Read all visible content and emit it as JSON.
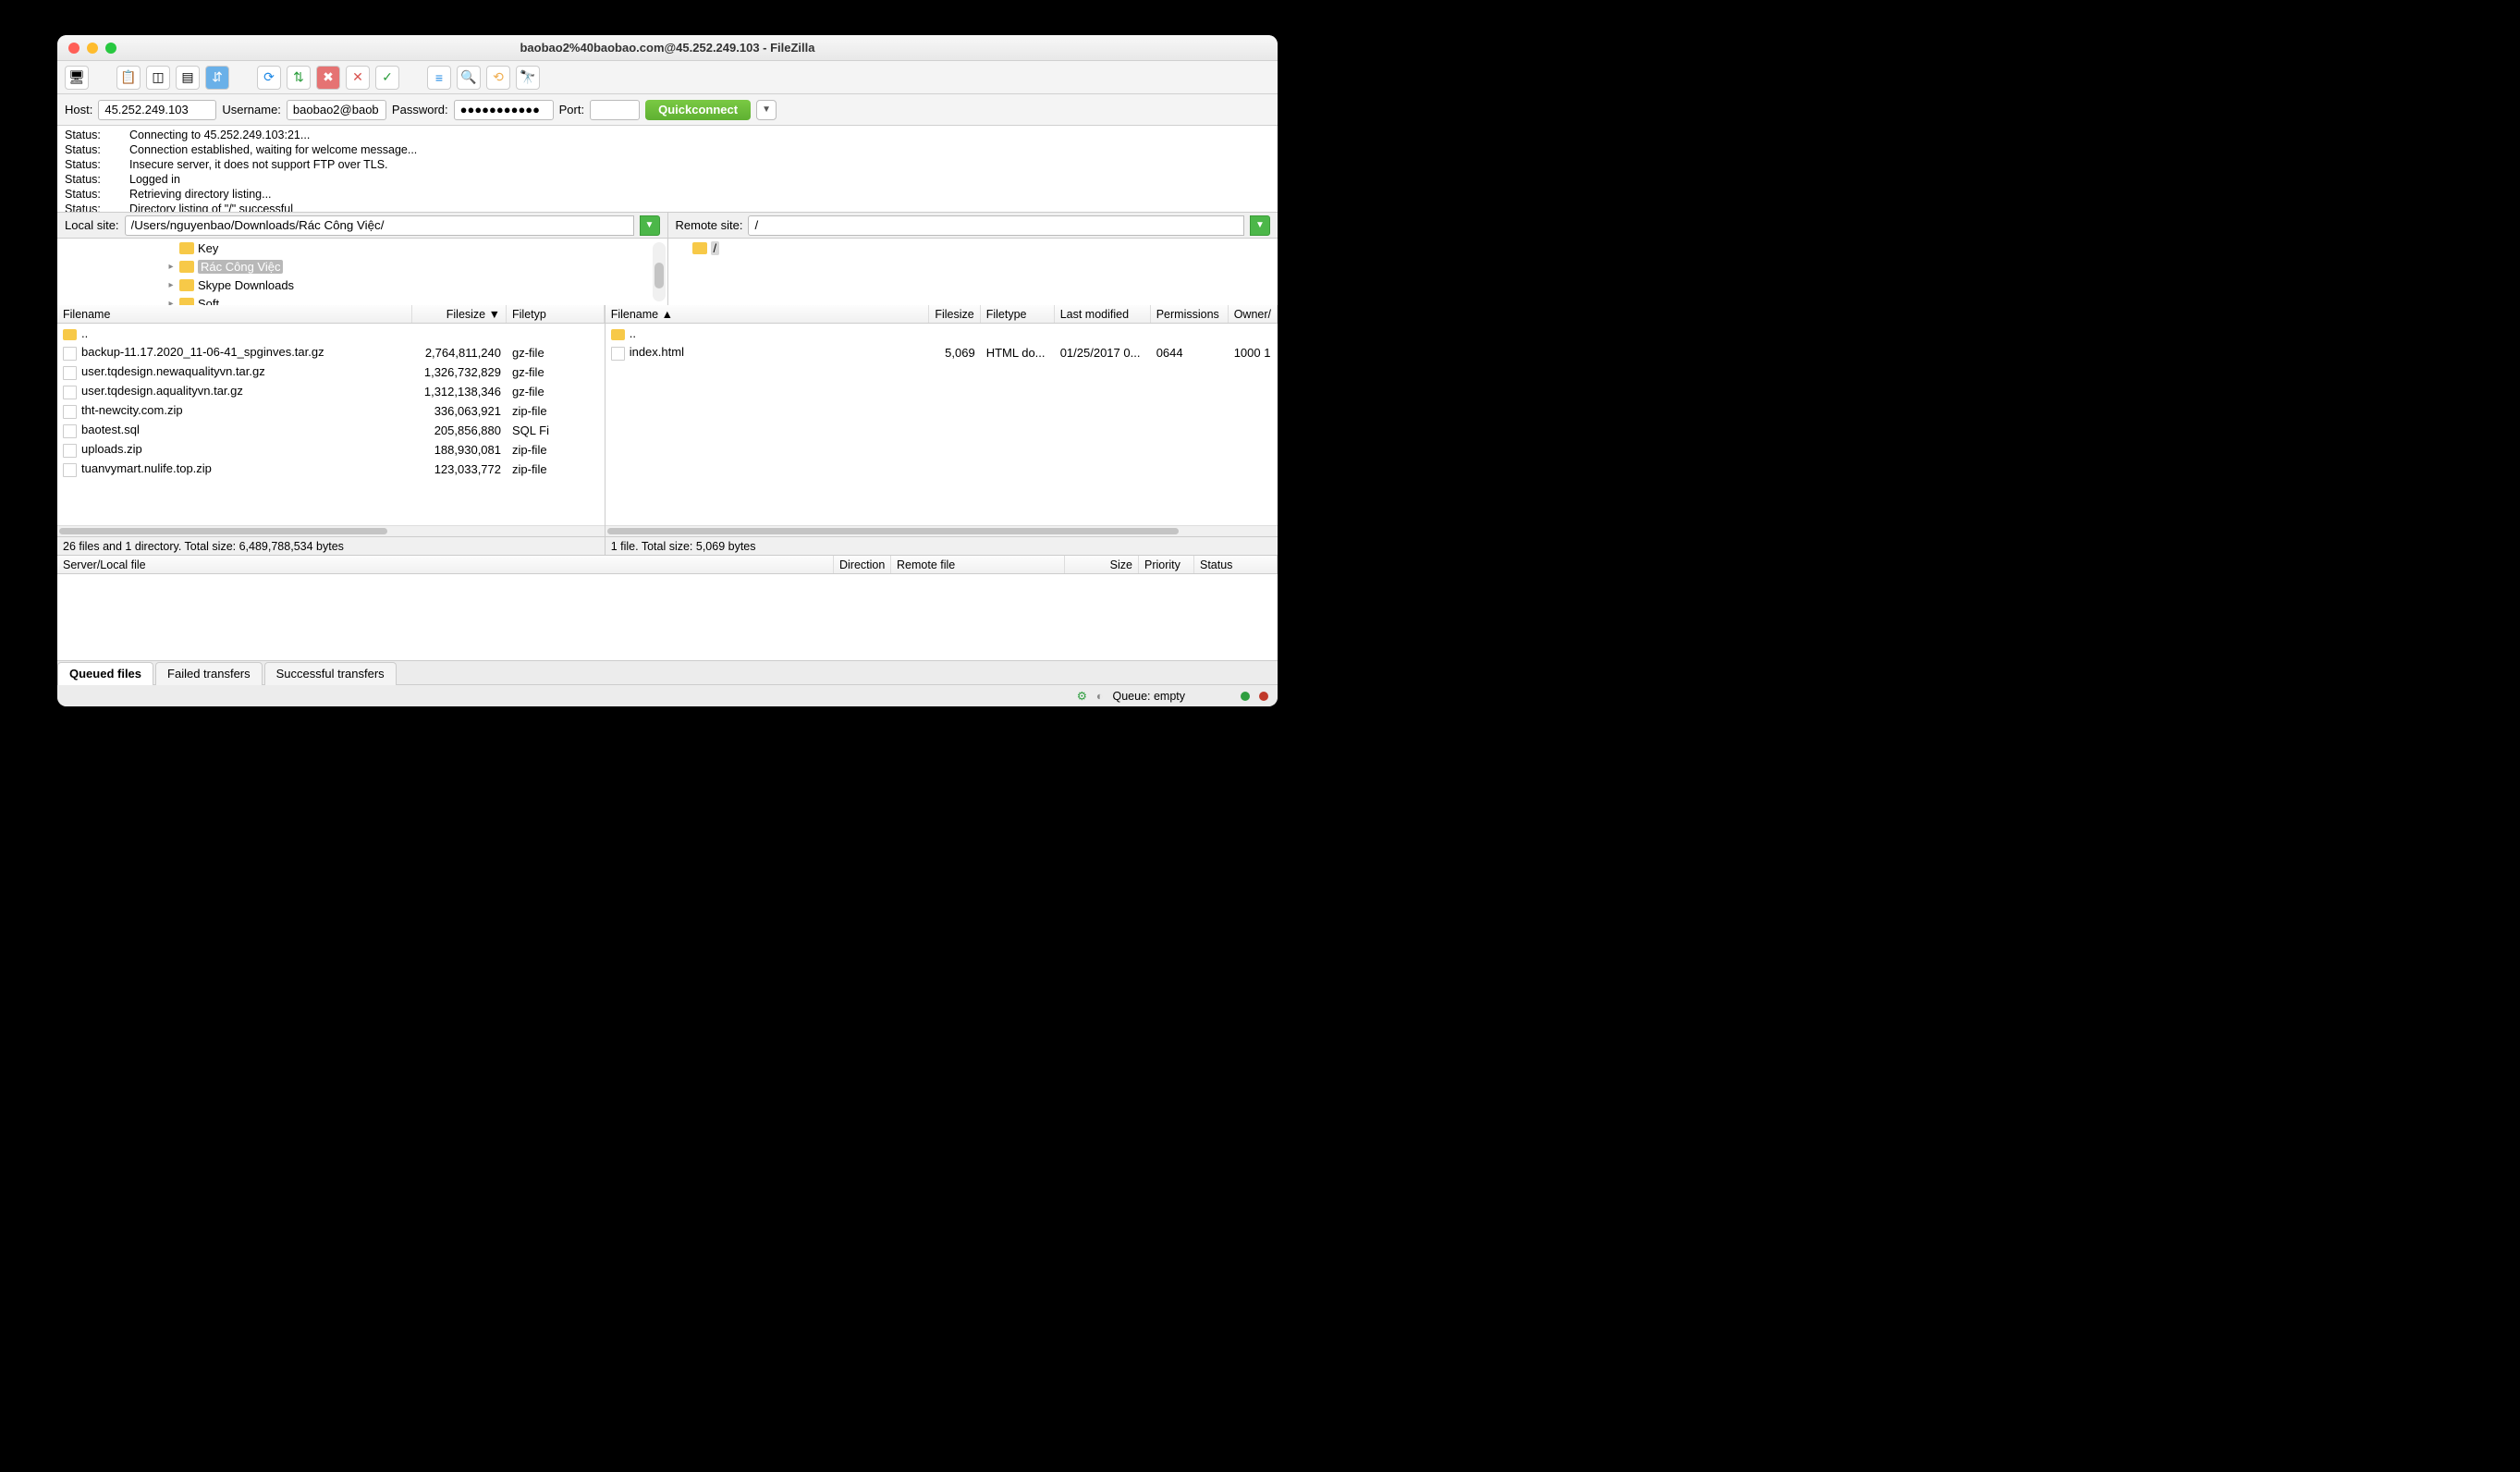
{
  "title": "baobao2%40baobao.com@45.252.249.103 - FileZilla",
  "quick": {
    "host_label": "Host:",
    "host": "45.252.249.103",
    "user_label": "Username:",
    "user": "baobao2@baob",
    "pass_label": "Password:",
    "pass": "●●●●●●●●●●●",
    "port_label": "Port:",
    "port": "",
    "connect": "Quickconnect"
  },
  "log": [
    {
      "k": "Status:",
      "v": "Connecting to 45.252.249.103:21..."
    },
    {
      "k": "Status:",
      "v": "Connection established, waiting for welcome message..."
    },
    {
      "k": "Status:",
      "v": "Insecure server, it does not support FTP over TLS."
    },
    {
      "k": "Status:",
      "v": "Logged in"
    },
    {
      "k": "Status:",
      "v": "Retrieving directory listing..."
    },
    {
      "k": "Status:",
      "v": "Directory listing of \"/\" successful"
    }
  ],
  "local": {
    "label": "Local site:",
    "path": "/Users/nguyenbao/Downloads/Rác Công Việc/",
    "tree": [
      {
        "indent": 118,
        "disc": "",
        "name": "Key"
      },
      {
        "indent": 118,
        "disc": "▸",
        "name": "Rác Công Việc",
        "sel": true
      },
      {
        "indent": 118,
        "disc": "▸",
        "name": "Skype Downloads"
      },
      {
        "indent": 118,
        "disc": "▸",
        "name": "Soft"
      }
    ],
    "cols": {
      "name": "Filename",
      "size": "Filesize",
      "sort": "▼",
      "type": "Filetyp"
    },
    "files": [
      {
        "icon": "folder",
        "name": "..",
        "size": "",
        "type": ""
      },
      {
        "icon": "file",
        "name": "backup-11.17.2020_11-06-41_spginves.tar.gz",
        "size": "2,764,811,240",
        "type": "gz-file"
      },
      {
        "icon": "file",
        "name": "user.tqdesign.newaqualityvn.tar.gz",
        "size": "1,326,732,829",
        "type": "gz-file"
      },
      {
        "icon": "file",
        "name": "user.tqdesign.aqualityvn.tar.gz",
        "size": "1,312,138,346",
        "type": "gz-file"
      },
      {
        "icon": "file",
        "name": "tht-newcity.com.zip",
        "size": "336,063,921",
        "type": "zip-file"
      },
      {
        "icon": "file",
        "name": "baotest.sql",
        "size": "205,856,880",
        "type": "SQL Fi"
      },
      {
        "icon": "file",
        "name": "uploads.zip",
        "size": "188,930,081",
        "type": "zip-file"
      },
      {
        "icon": "file",
        "name": "tuanvymart.nulife.top.zip",
        "size": "123,033,772",
        "type": "zip-file"
      }
    ],
    "status": "26 files and 1 directory. Total size: 6,489,788,534 bytes"
  },
  "remote": {
    "label": "Remote site:",
    "path": "/",
    "tree_root": "/",
    "cols": {
      "name": "Filename",
      "sort": "▲",
      "size": "Filesize",
      "type": "Filetype",
      "mod": "Last modified",
      "perm": "Permissions",
      "own": "Owner/"
    },
    "files": [
      {
        "icon": "folder",
        "name": "..",
        "size": "",
        "type": "",
        "mod": "",
        "perm": "",
        "own": ""
      },
      {
        "icon": "file",
        "name": "index.html",
        "size": "5,069",
        "type": "HTML do...",
        "mod": "01/25/2017 0...",
        "perm": "0644",
        "own": "1000 1"
      }
    ],
    "status": "1 file. Total size: 5,069 bytes"
  },
  "queue_cols": {
    "sl": "Server/Local file",
    "dir": "Direction",
    "rf": "Remote file",
    "sz": "Size",
    "pr": "Priority",
    "st": "Status"
  },
  "tabs": {
    "q": "Queued files",
    "f": "Failed transfers",
    "s": "Successful transfers"
  },
  "statusbar": {
    "q": "Queue: empty"
  }
}
